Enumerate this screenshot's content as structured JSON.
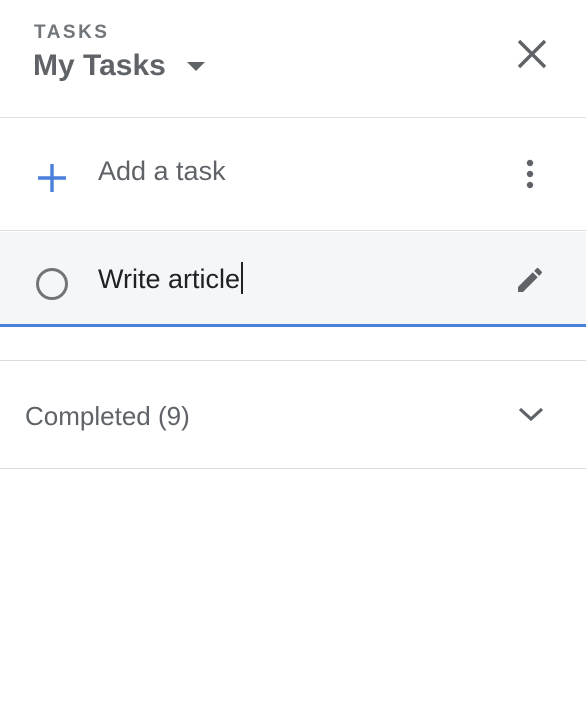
{
  "header": {
    "app_label": "TASKS",
    "list_title": "My Tasks",
    "dropdown_icon": "arrow-drop-down-icon",
    "close_icon": "close-icon"
  },
  "add_task": {
    "label": "Add a task",
    "icon": "plus-icon",
    "accent_color": "#4a7fdc",
    "more_icon": "more-vert-icon"
  },
  "tasks": [
    {
      "title": "Write article",
      "completed": false,
      "editing": true,
      "check_icon": "circle-outline-icon",
      "edit_icon": "pencil-icon"
    }
  ],
  "completed_section": {
    "label": "Completed (9)",
    "count": 9,
    "chevron_icon": "chevron-down-icon"
  },
  "colors": {
    "accent": "#4a7fdc",
    "editing_row_bg": "#f5f6f8",
    "text_primary": "#202124",
    "text_secondary": "#5f6368"
  }
}
